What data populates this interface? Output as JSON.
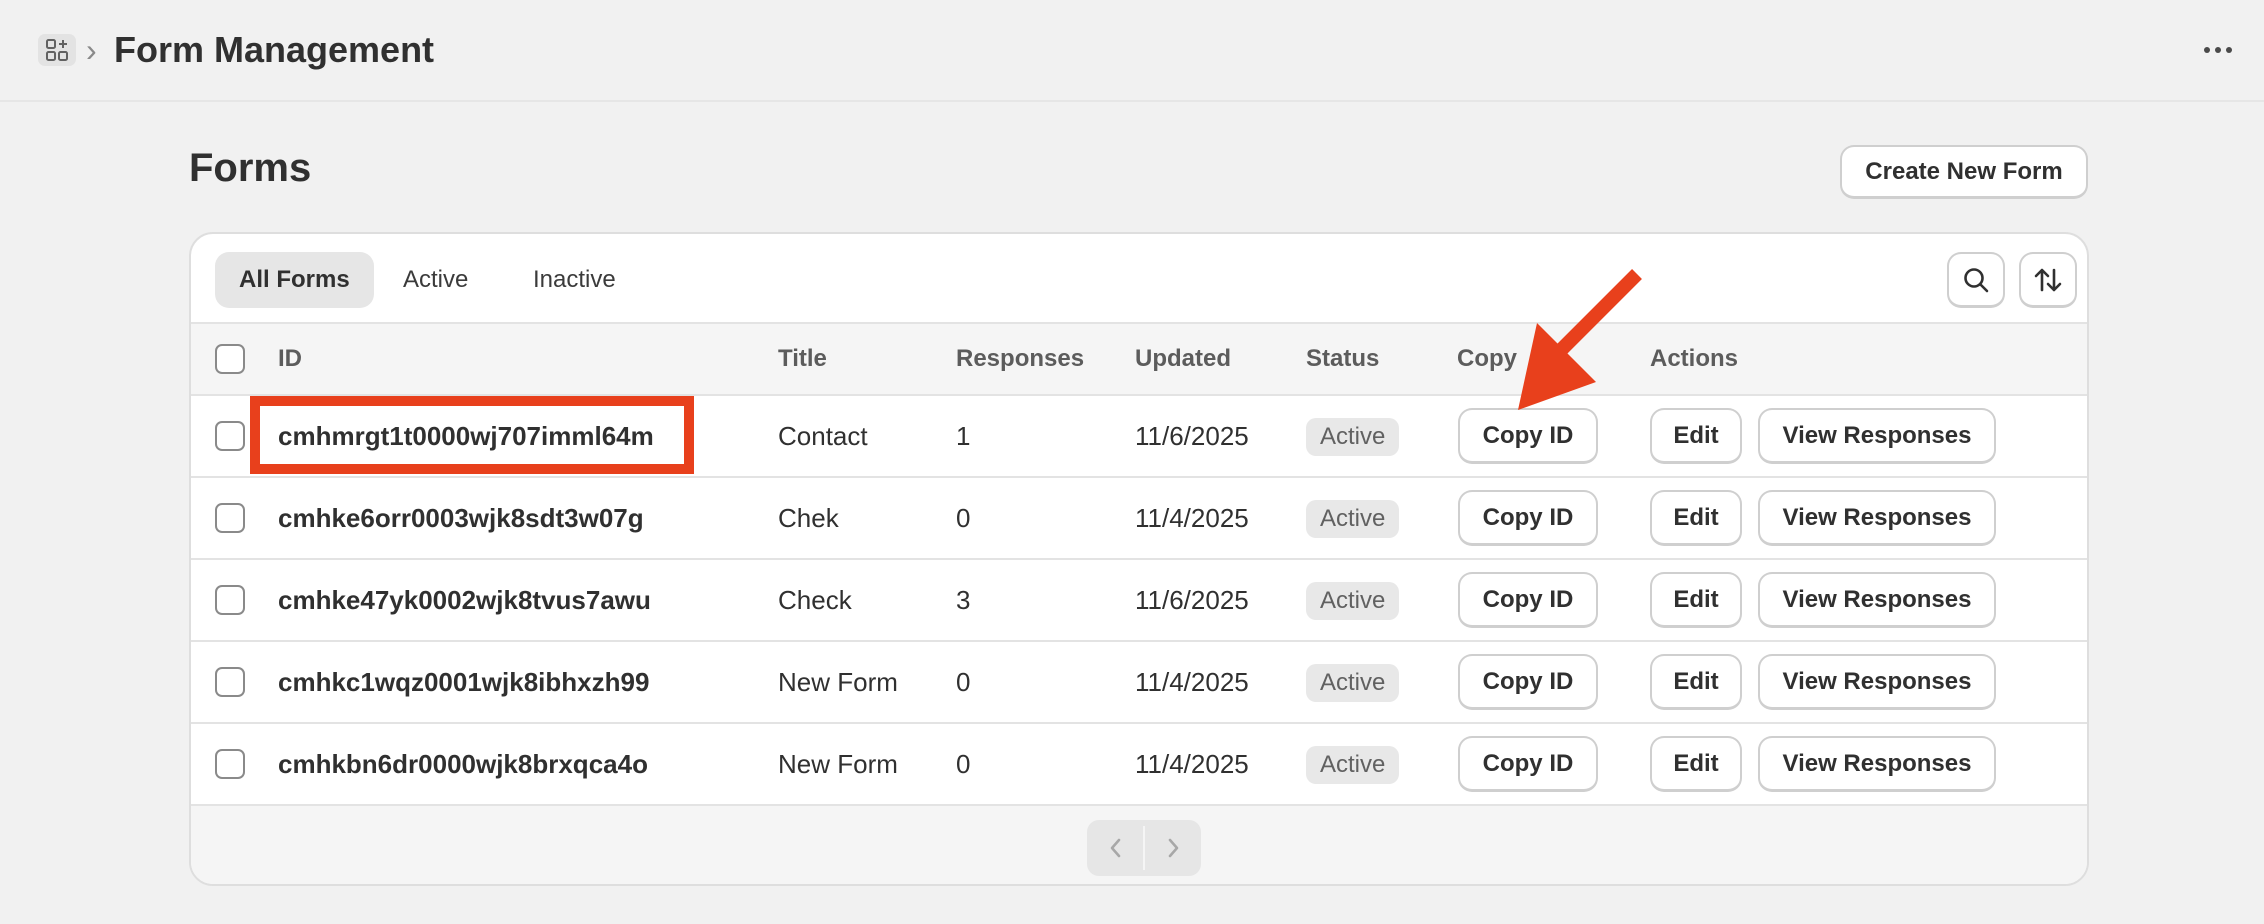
{
  "header": {
    "breadcrumb_separator": "›",
    "title": "Form Management",
    "app_icon": "apps-icon",
    "more_icon": "more-horizontal-icon"
  },
  "page": {
    "title": "Forms",
    "create_button": "Create New Form"
  },
  "tabs": [
    {
      "label": "All Forms",
      "selected": true
    },
    {
      "label": "Active",
      "selected": false
    },
    {
      "label": "Inactive",
      "selected": false
    }
  ],
  "toolbar_icons": [
    "search-icon",
    "sort-icon"
  ],
  "table": {
    "columns": [
      "ID",
      "Title",
      "Responses",
      "Updated",
      "Status",
      "Copy",
      "Actions"
    ],
    "rows": [
      {
        "id": "cmhmrgt1t0000wj707imml64m",
        "title": "Contact",
        "responses": "1",
        "updated": "11/6/2025",
        "status": "Active"
      },
      {
        "id": "cmhke6orr0003wjk8sdt3w07g",
        "title": "Chek",
        "responses": "0",
        "updated": "11/4/2025",
        "status": "Active"
      },
      {
        "id": "cmhke47yk0002wjk8tvus7awu",
        "title": "Check",
        "responses": "3",
        "updated": "11/6/2025",
        "status": "Active"
      },
      {
        "id": "cmhkc1wqz0001wjk8ibhxzh99",
        "title": "New Form",
        "responses": "0",
        "updated": "11/4/2025",
        "status": "Active"
      },
      {
        "id": "cmhkbn6dr0000wjk8brxqca4o",
        "title": "New Form",
        "responses": "0",
        "updated": "11/4/2025",
        "status": "Active"
      }
    ],
    "row_actions": {
      "copy": "Copy ID",
      "edit": "Edit",
      "view": "View Responses"
    }
  },
  "pagination": {
    "prev_icon": "chevron-left-icon",
    "next_icon": "chevron-right-icon"
  },
  "annotations": {
    "highlight_color": "#e8401c",
    "arrow_color": "#e8401c"
  }
}
